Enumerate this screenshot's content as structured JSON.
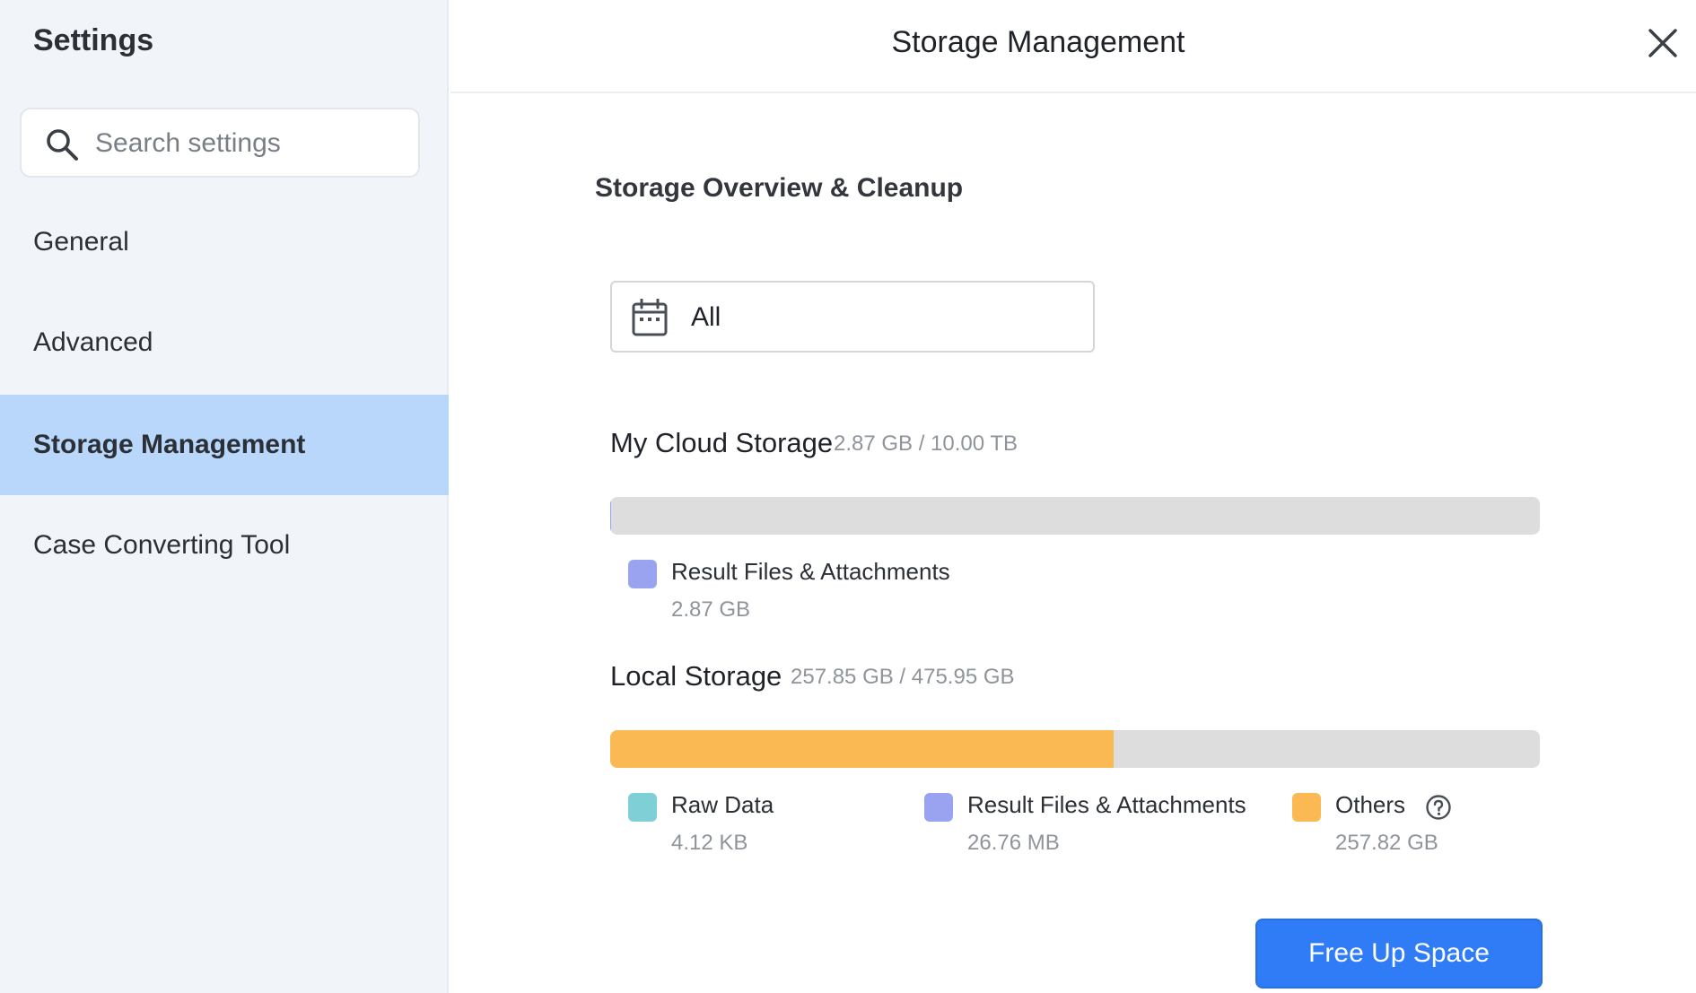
{
  "sidebar": {
    "title": "Settings",
    "search": {
      "placeholder": "Search settings",
      "value": ""
    },
    "items": [
      {
        "label": "General",
        "active": false
      },
      {
        "label": "Advanced",
        "active": false
      },
      {
        "label": "Storage Management",
        "active": true
      },
      {
        "label": "Case Converting Tool",
        "active": false
      }
    ]
  },
  "header": {
    "title": "Storage Management"
  },
  "content": {
    "section_title": "Storage Overview & Cleanup",
    "date_filter": {
      "value": "All"
    },
    "cloud": {
      "label": "My Cloud Storage",
      "usage": "2.87 GB / 10.00 TB",
      "used_fraction": 0.0003,
      "fill_color": "#9aa3f0",
      "legend": [
        {
          "name": "Result Files & Attachments",
          "size": "2.87 GB",
          "color": "#9aa3f0"
        }
      ]
    },
    "local": {
      "label": "Local Storage",
      "usage": "257.85 GB / 475.95 GB",
      "used_fraction": 0.5418,
      "fill_color": "#fbb954",
      "legend": [
        {
          "name": "Raw Data",
          "size": "4.12 KB",
          "color": "#7fd0d6"
        },
        {
          "name": "Result Files & Attachments",
          "size": "26.76 MB",
          "color": "#9aa3f0"
        },
        {
          "name": "Others",
          "size": "257.82 GB",
          "color": "#fbb954"
        }
      ]
    },
    "free_up_label": "Free Up Space"
  },
  "icons": {
    "search": "search-icon",
    "close": "close-icon",
    "calendar": "calendar-icon",
    "help": "help-icon"
  }
}
